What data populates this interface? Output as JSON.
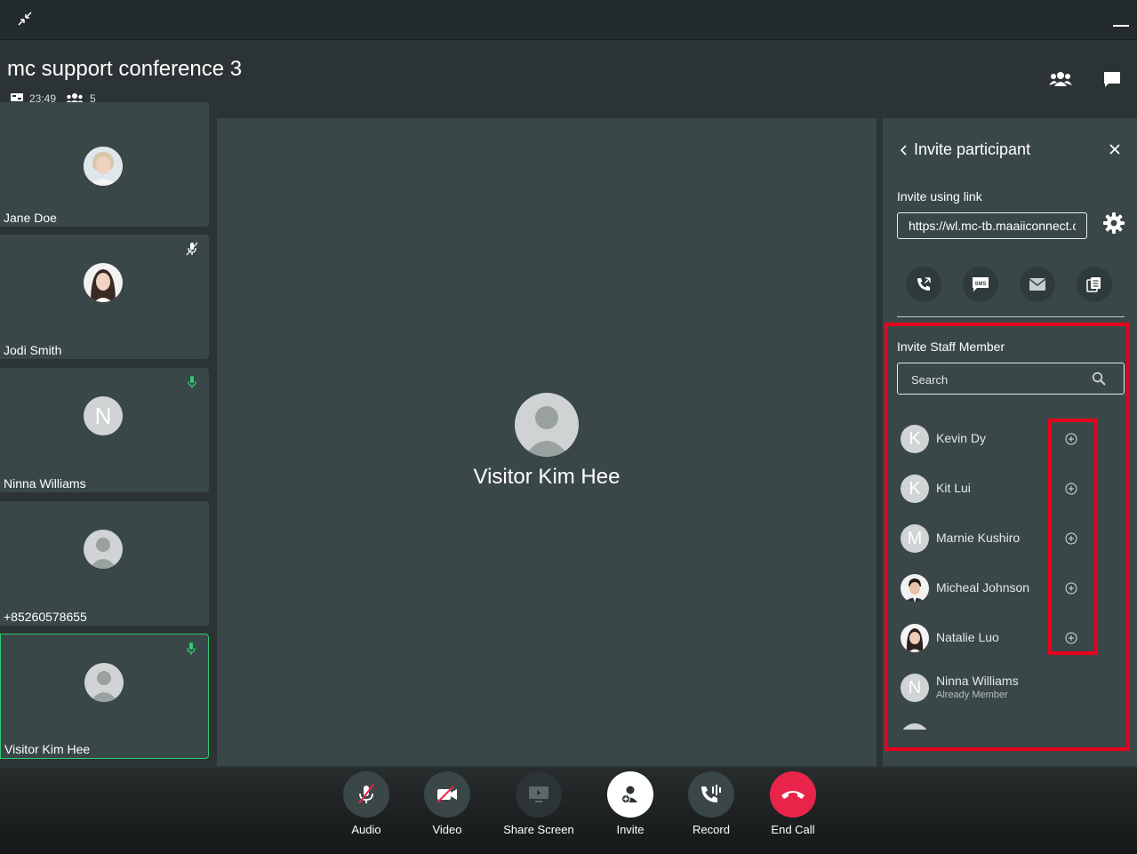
{
  "header": {
    "title": "mc support conference 3",
    "duration": "23:49",
    "participant_count": "5"
  },
  "tiles": [
    {
      "name": "Jane Doe",
      "mic": "none"
    },
    {
      "name": "Jodi Smith",
      "mic": "muted"
    },
    {
      "name": "Ninna Williams",
      "initial": "N",
      "mic": "active"
    },
    {
      "name": "+85260578655",
      "mic": "none"
    },
    {
      "name": "Visitor Kim Hee",
      "mic": "active",
      "selected": true
    }
  ],
  "main": {
    "speaker_name": "Visitor Kim Hee"
  },
  "invite_panel": {
    "title": "Invite participant",
    "link_label": "Invite using link",
    "link_value": "https://wl.mc-tb.maaiiconnect.com",
    "share_options": [
      "call-icon",
      "sms-icon",
      "email-icon",
      "copy-icon"
    ],
    "staff_label": "Invite Staff Member",
    "search_placeholder": "Search",
    "staff": [
      {
        "name": "Kevin Dy",
        "initial": "K"
      },
      {
        "name": "Kit Lui",
        "initial": "K"
      },
      {
        "name": "Marnie Kushiro",
        "initial": "M"
      },
      {
        "name": "Micheal Johnson",
        "initial": ""
      },
      {
        "name": "Natalie Luo",
        "initial": ""
      },
      {
        "name": "Ninna Williams",
        "initial": "N",
        "status": "Already Member"
      }
    ]
  },
  "controls": [
    {
      "label": "Audio"
    },
    {
      "label": "Video"
    },
    {
      "label": "Share Screen"
    },
    {
      "label": "Invite"
    },
    {
      "label": "Record"
    },
    {
      "label": "End Call"
    }
  ],
  "colors": {
    "accent_green": "#2ecc71",
    "end_call_red": "#e8244a",
    "highlight_red": "#e8001c"
  }
}
